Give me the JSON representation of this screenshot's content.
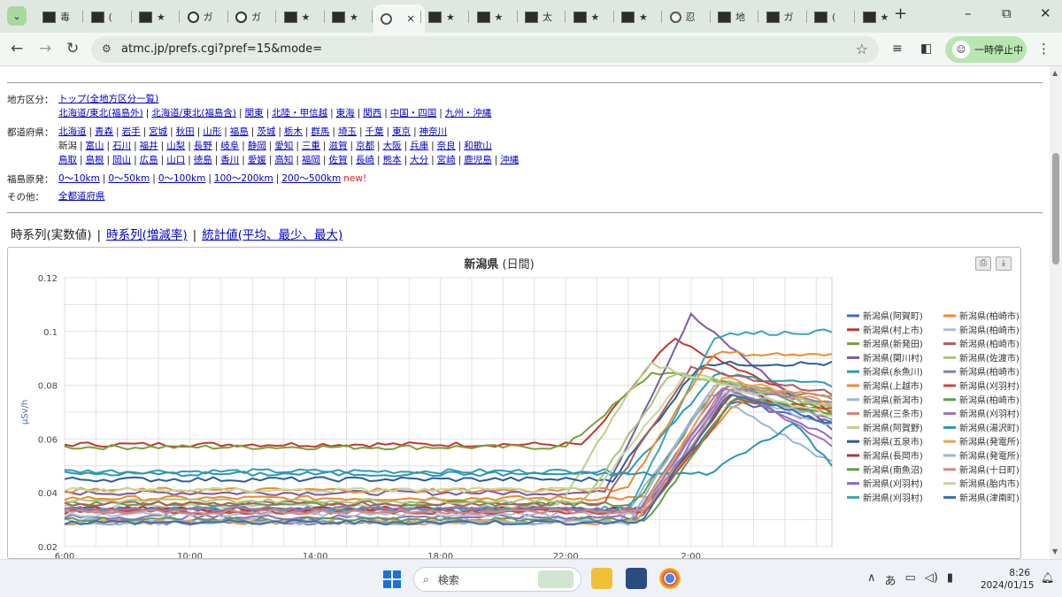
{
  "browser": {
    "tabs": [
      {
        "label": "毒",
        "icon": "site-icon"
      },
      {
        "label": "(",
        "icon": "site-icon"
      },
      {
        "label": "★",
        "icon": "site-icon"
      },
      {
        "label": "ガ",
        "icon": "info-icon"
      },
      {
        "label": "ガ",
        "icon": "info-icon"
      },
      {
        "label": "★",
        "icon": "site-icon"
      },
      {
        "label": "★",
        "icon": "site-icon"
      },
      {
        "label": "",
        "icon": "globe-icon",
        "active": true
      },
      {
        "label": "★",
        "icon": "site-icon"
      },
      {
        "label": "★",
        "icon": "site-icon"
      },
      {
        "label": "太",
        "icon": "site-icon"
      },
      {
        "label": "★",
        "icon": "site-icon"
      },
      {
        "label": "★",
        "icon": "site-icon"
      },
      {
        "label": "忍",
        "icon": "globe-icon"
      },
      {
        "label": "地",
        "icon": "site-icon"
      },
      {
        "label": "ガ",
        "icon": "site-icon"
      },
      {
        "label": "(",
        "icon": "site-icon"
      },
      {
        "label": "★",
        "icon": "site-icon"
      }
    ],
    "active_tab_close": "✕",
    "url": "atmc.jp/prefs.cgi?pref=15&mode=",
    "pause_label": "一時停止中"
  },
  "regions": {
    "label": "地方区分：",
    "top_link": "トップ(全地方区分一覧)",
    "items": [
      "北海道/東北(福島外)",
      "北海道/東北(福島含)",
      "関東",
      "北陸・甲信越",
      "東海",
      "関西",
      "中国・四国",
      "九州・沖縄"
    ]
  },
  "prefectures": {
    "label": "都道府県：",
    "rows": [
      [
        "北海道",
        "青森",
        "岩手",
        "宮城",
        "秋田",
        "山形",
        "福島",
        "茨城",
        "栃木",
        "群馬",
        "埼玉",
        "千葉",
        "東京",
        "神奈川"
      ],
      [
        "新潟",
        "富山",
        "石川",
        "福井",
        "山梨",
        "長野",
        "岐阜",
        "静岡",
        "愛知",
        "三重",
        "滋賀",
        "京都",
        "大阪",
        "兵庫",
        "奈良",
        "和歌山"
      ],
      [
        "鳥取",
        "島根",
        "岡山",
        "広島",
        "山口",
        "徳島",
        "香川",
        "愛媛",
        "高知",
        "福岡",
        "佐賀",
        "長崎",
        "熊本",
        "大分",
        "宮崎",
        "鹿児島",
        "沖縄"
      ]
    ],
    "current": "新潟"
  },
  "fukushima": {
    "label": "福島原発：",
    "items": [
      "0〜10km",
      "0〜50km",
      "0〜100km",
      "100〜200km",
      "200〜500km"
    ],
    "new_badge": "new!"
  },
  "other": {
    "label": "その他：",
    "link": "全都道府県"
  },
  "view_tabs": {
    "current": "時系列(実数値)",
    "links": [
      "時系列(増減率)",
      "統計値(平均、最少、最大)"
    ]
  },
  "taskbar": {
    "search_placeholder": "検索",
    "time": "8:26",
    "date": "2024/01/15",
    "ime": "あ"
  },
  "chart_data": {
    "type": "line",
    "title": "新潟県",
    "subtitle": "(日間)",
    "ylabel": "μSv/h",
    "ylim": [
      0.02,
      0.12
    ],
    "yticks": [
      "0.12",
      "0.1",
      "0.08",
      "0.06",
      "0.04",
      "0.02"
    ],
    "xticks": [
      "6:00",
      "10:00",
      "14:00",
      "18:00",
      "22:00",
      "2:00"
    ],
    "x_hours": [
      6,
      30.5
    ],
    "legend_position": "right",
    "grid": true,
    "series": [
      {
        "name": "新潟県(阿賀町)",
        "color": "#3f6fb5",
        "base": 0.034,
        "peak": 0.074,
        "rise": 25.5,
        "end": 0.066
      },
      {
        "name": "新潟県(村上市)",
        "color": "#c0392b",
        "base": 0.058,
        "peak": 0.097,
        "rise": 23.6,
        "end": 0.07
      },
      {
        "name": "新潟県(新発田)",
        "color": "#7ba03a",
        "base": 0.057,
        "peak": 0.085,
        "rise": 23.0,
        "end": 0.075
      },
      {
        "name": "新潟県(関川村)",
        "color": "#7b5aa6",
        "base": 0.04,
        "peak": 0.106,
        "rise": 24.2,
        "end": 0.064
      },
      {
        "name": "新潟県(糸魚川)",
        "color": "#2e9bbb",
        "base": 0.048,
        "peak": 0.084,
        "rise": 25.0,
        "end": 0.08
      },
      {
        "name": "新潟県(上越市)",
        "color": "#f08a24",
        "base": 0.038,
        "peak": 0.075,
        "rise": 25.8,
        "end": 0.07
      },
      {
        "name": "新潟県(新潟市)",
        "color": "#9bb5d6",
        "base": 0.03,
        "peak": 0.077,
        "rise": 24.8,
        "end": 0.051
      },
      {
        "name": "新潟県(三条市)",
        "color": "#d97b7b",
        "base": 0.033,
        "peak": 0.08,
        "rise": 25.3,
        "end": 0.073
      },
      {
        "name": "新潟県(阿賀野)",
        "color": "#b9d08a",
        "base": 0.035,
        "peak": 0.088,
        "rise": 22.8,
        "end": 0.072
      },
      {
        "name": "新潟県(五泉市)",
        "color": "#2c5d94",
        "base": 0.045,
        "peak": 0.088,
        "rise": 24.5,
        "end": 0.088
      },
      {
        "name": "新潟県(長岡市)",
        "color": "#a23a3a",
        "base": 0.034,
        "peak": 0.078,
        "rise": 25.6,
        "end": 0.068
      },
      {
        "name": "新潟県(南魚沼)",
        "color": "#5f9e4a",
        "base": 0.036,
        "peak": 0.082,
        "rise": 25.2,
        "end": 0.07
      },
      {
        "name": "新潟県(刈羽村)",
        "color": "#8e6cc0",
        "base": 0.031,
        "peak": 0.079,
        "rise": 25.4,
        "end": 0.06
      },
      {
        "name": "新潟県(刈羽村)",
        "color": "#3aa6b5",
        "base": 0.034,
        "peak": 0.099,
        "rise": 25.0,
        "end": 0.1
      },
      {
        "name": "新潟県(柏崎市)",
        "color": "#ee8b2f",
        "base": 0.041,
        "peak": 0.092,
        "rise": 24.9,
        "end": 0.091
      },
      {
        "name": "新潟県(柏崎市)",
        "color": "#a9bfdc",
        "base": 0.032,
        "peak": 0.078,
        "rise": 25.3,
        "end": 0.065
      },
      {
        "name": "新潟県(柏崎市)",
        "color": "#b05c5c",
        "base": 0.036,
        "peak": 0.087,
        "rise": 24.2,
        "end": 0.077
      },
      {
        "name": "新潟県(佐渡市)",
        "color": "#a7c57e",
        "base": 0.037,
        "peak": 0.085,
        "rise": 23.6,
        "end": 0.072
      },
      {
        "name": "新潟県(柏崎市)",
        "color": "#8f7ab2",
        "base": 0.029,
        "peak": 0.079,
        "rise": 25.1,
        "end": 0.074
      },
      {
        "name": "新潟県(刈羽村)",
        "color": "#c94a3f",
        "base": 0.033,
        "peak": 0.075,
        "rise": 25.6,
        "end": 0.071
      },
      {
        "name": "新潟県(柏崎市)",
        "color": "#5f9e4a",
        "base": 0.03,
        "peak": 0.076,
        "rise": 25.6,
        "end": 0.069
      },
      {
        "name": "新潟県(刈羽村)",
        "color": "#9c74b8",
        "base": 0.034,
        "peak": 0.08,
        "rise": 25.4,
        "end": 0.058
      },
      {
        "name": "新潟県(湯沢町)",
        "color": "#2c96b4",
        "base": 0.047,
        "peak": 0.066,
        "rise": 27.5,
        "end": 0.05
      },
      {
        "name": "新潟県(発電所)",
        "color": "#f0a050",
        "base": 0.029,
        "peak": 0.083,
        "rise": 25.2,
        "end": 0.073
      },
      {
        "name": "新潟県(発電所)",
        "color": "#9fb3d0",
        "base": 0.029,
        "peak": 0.081,
        "rise": 25.0,
        "end": 0.067
      },
      {
        "name": "新潟県(十日町)",
        "color": "#d08a84",
        "base": 0.033,
        "peak": 0.079,
        "rise": 25.5,
        "end": 0.076
      },
      {
        "name": "新潟県(胎内市)",
        "color": "#c3d89a",
        "base": 0.041,
        "peak": 0.084,
        "rise": 24.0,
        "end": 0.069
      },
      {
        "name": "新潟県(津南町)",
        "color": "#3b6fa8",
        "base": 0.029,
        "peak": 0.077,
        "rise": 25.4,
        "end": 0.066
      }
    ]
  }
}
